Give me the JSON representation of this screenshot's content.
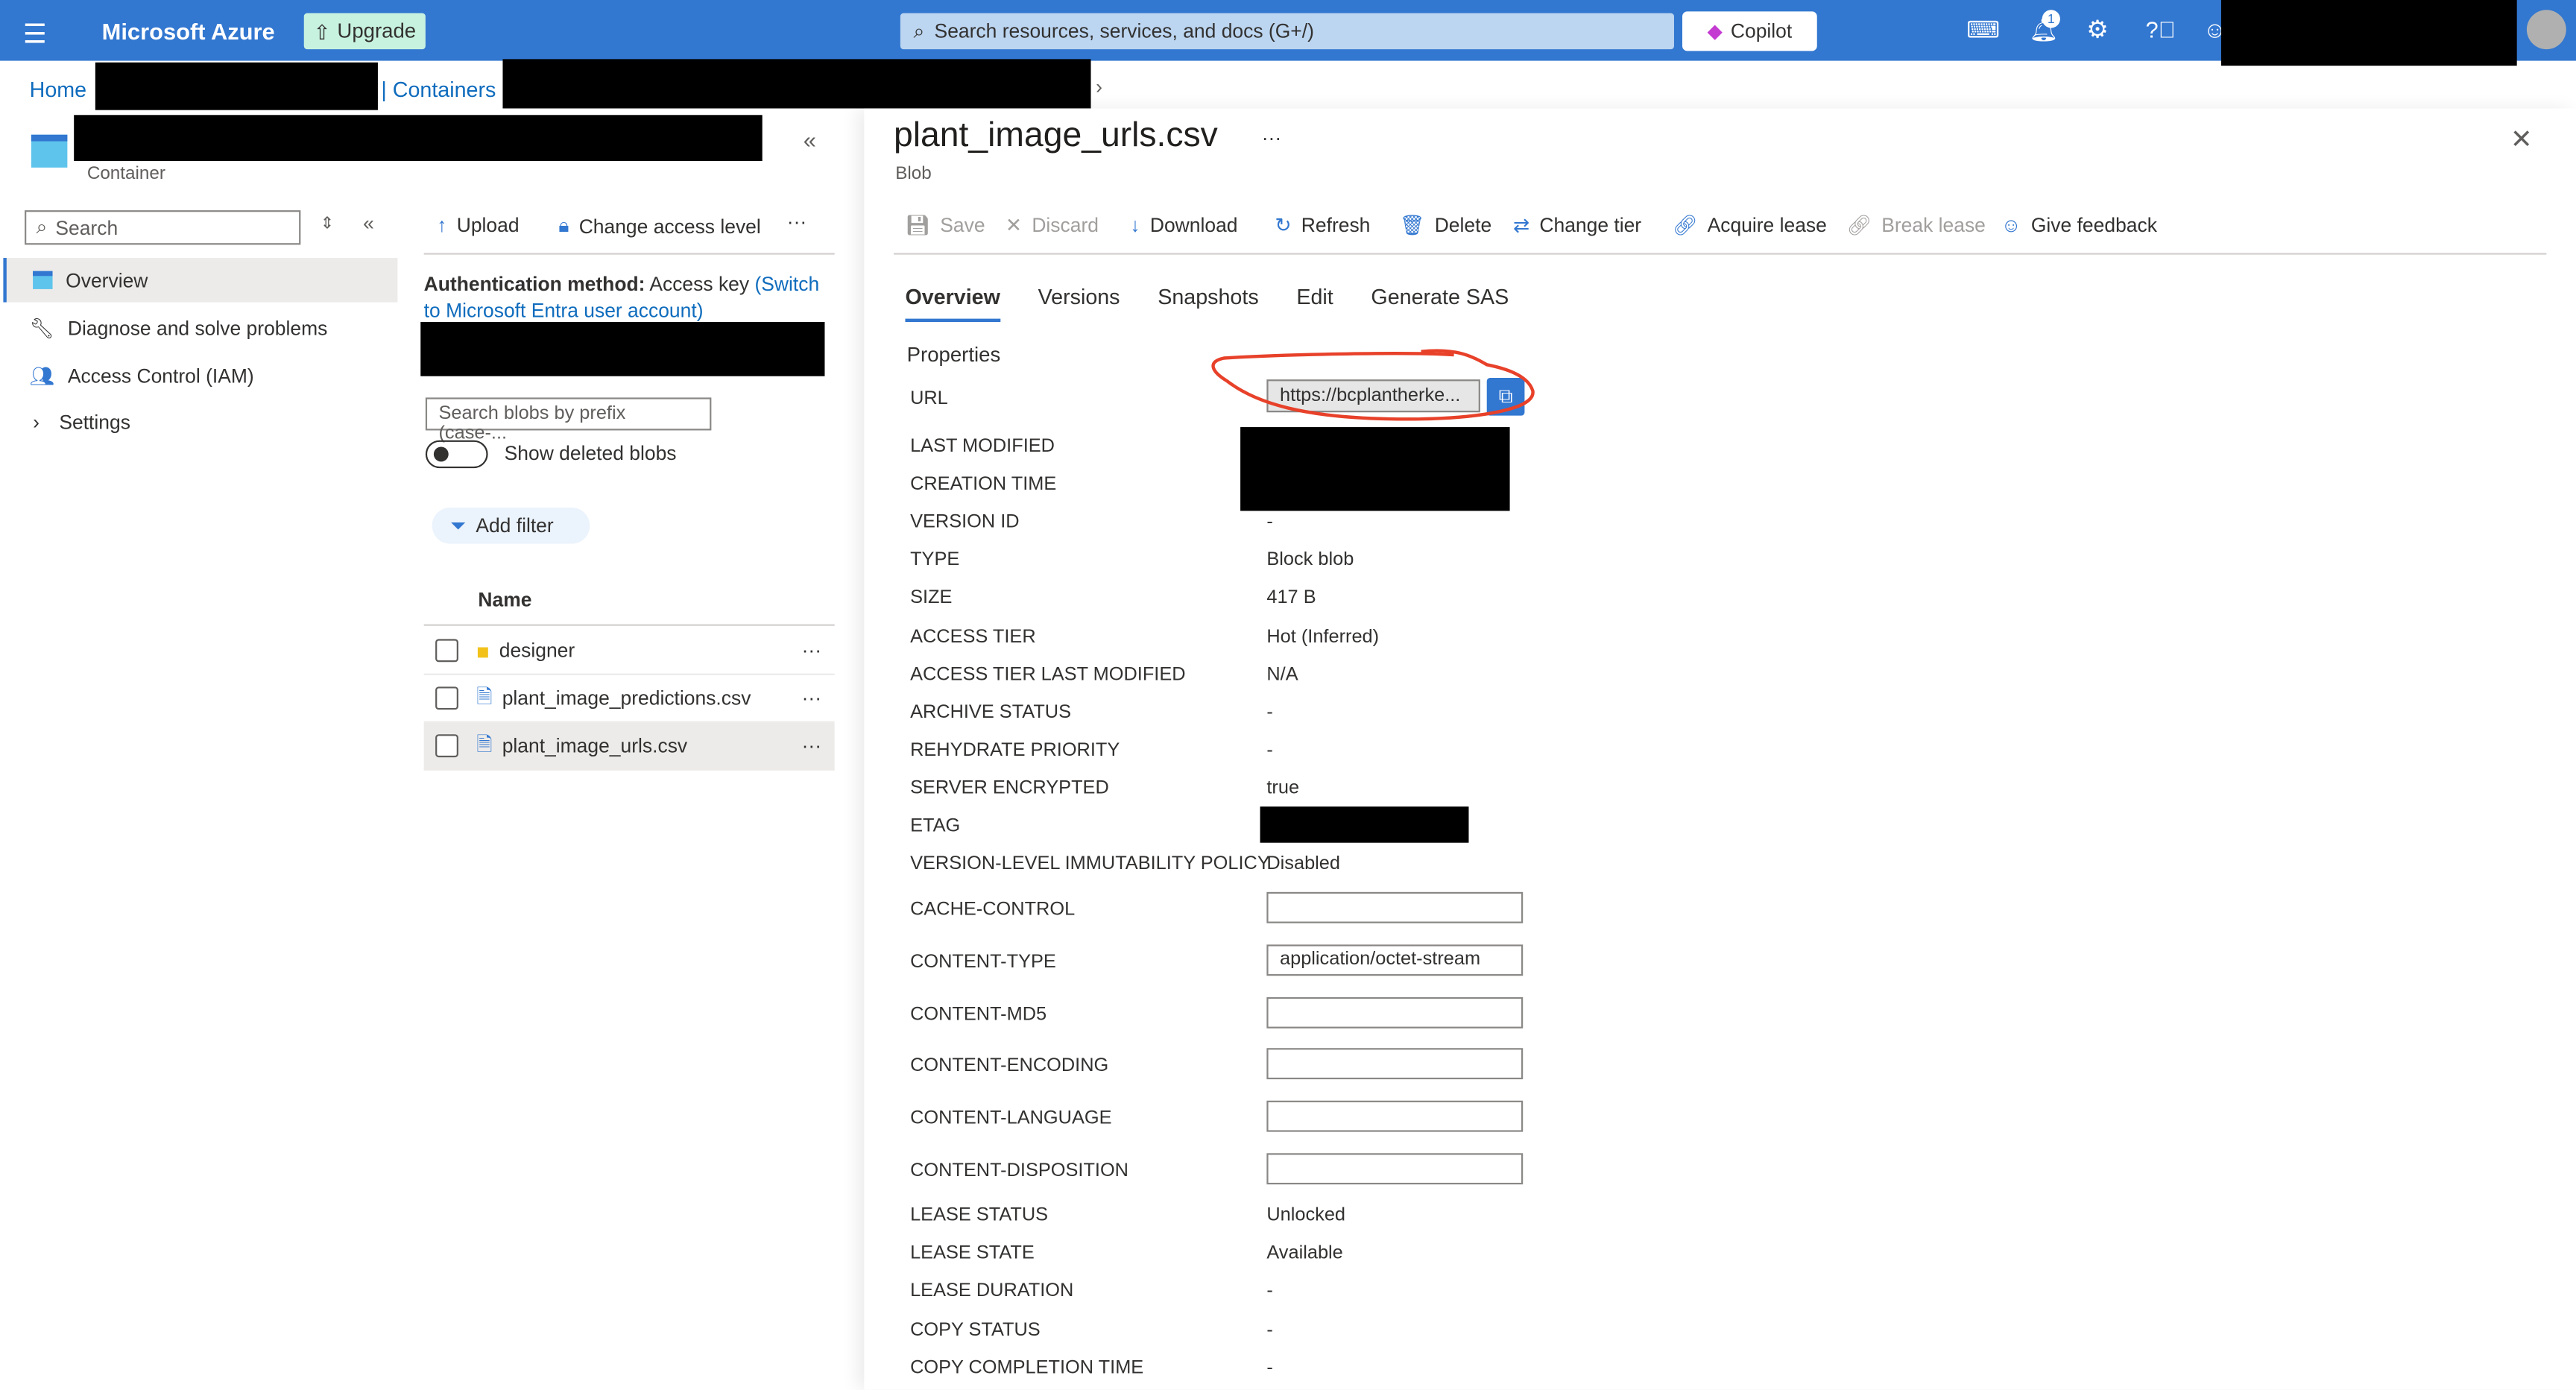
{
  "topbar": {
    "brand": "Microsoft Azure",
    "upgrade": "Upgrade",
    "search_placeholder": "Search resources, services, and docs (G+/)",
    "copilot": "Copilot",
    "notification_count": "1",
    "accent": "#3277d0"
  },
  "breadcrumb": {
    "home": "Home",
    "containers": "| Containers"
  },
  "left": {
    "resource_type": "Container",
    "search_placeholder": "Search",
    "nav": [
      {
        "label": "Overview"
      },
      {
        "label": "Diagnose and solve problems"
      },
      {
        "label": "Access Control (IAM)"
      },
      {
        "label": "Settings"
      }
    ]
  },
  "middle": {
    "toolbar": {
      "upload": "Upload",
      "change_access": "Change access level"
    },
    "auth_label": "Authentication method:",
    "auth_value": "Access key",
    "auth_switch": "(Switch to Microsoft Entra user account)",
    "blob_search_placeholder": "Search blobs by prefix (case-...",
    "show_deleted": "Show deleted blobs",
    "add_filter": "Add filter",
    "col_name": "Name",
    "items": [
      {
        "name": "designer",
        "type": "folder"
      },
      {
        "name": "plant_image_predictions.csv",
        "type": "file"
      },
      {
        "name": "plant_image_urls.csv",
        "type": "file"
      }
    ]
  },
  "blob": {
    "title": "plant_image_urls.csv",
    "subtitle": "Blob",
    "toolbar": {
      "save": "Save",
      "discard": "Discard",
      "download": "Download",
      "refresh": "Refresh",
      "delete": "Delete",
      "change_tier": "Change tier",
      "acquire_lease": "Acquire lease",
      "break_lease": "Break lease",
      "feedback": "Give feedback"
    },
    "tabs": [
      "Overview",
      "Versions",
      "Snapshots",
      "Edit",
      "Generate SAS"
    ],
    "properties_heading": "Properties",
    "url_label": "URL",
    "url_value": "https://bcplantherke...",
    "props": [
      {
        "label": "LAST MODIFIED",
        "value": ""
      },
      {
        "label": "CREATION TIME",
        "value": ""
      },
      {
        "label": "VERSION ID",
        "value": "-"
      },
      {
        "label": "TYPE",
        "value": "Block blob"
      },
      {
        "label": "SIZE",
        "value": "417 B"
      },
      {
        "label": "ACCESS TIER",
        "value": "Hot (Inferred)"
      },
      {
        "label": "ACCESS TIER LAST MODIFIED",
        "value": "N/A"
      },
      {
        "label": "ARCHIVE STATUS",
        "value": "-"
      },
      {
        "label": "REHYDRATE PRIORITY",
        "value": "-"
      },
      {
        "label": "SERVER ENCRYPTED",
        "value": "true"
      },
      {
        "label": "ETAG",
        "value": ""
      },
      {
        "label": "VERSION-LEVEL IMMUTABILITY POLICY",
        "value": "Disabled"
      }
    ],
    "fields": [
      {
        "label": "CACHE-CONTROL",
        "value": ""
      },
      {
        "label": "CONTENT-TYPE",
        "value": "application/octet-stream"
      },
      {
        "label": "CONTENT-MD5",
        "value": ""
      },
      {
        "label": "CONTENT-ENCODING",
        "value": ""
      },
      {
        "label": "CONTENT-LANGUAGE",
        "value": ""
      },
      {
        "label": "CONTENT-DISPOSITION",
        "value": ""
      }
    ],
    "lease": [
      {
        "label": "LEASE STATUS",
        "value": "Unlocked"
      },
      {
        "label": "LEASE STATE",
        "value": "Available"
      },
      {
        "label": "LEASE DURATION",
        "value": "-"
      },
      {
        "label": "COPY STATUS",
        "value": "-"
      },
      {
        "label": "COPY COMPLETION TIME",
        "value": "-"
      }
    ]
  }
}
